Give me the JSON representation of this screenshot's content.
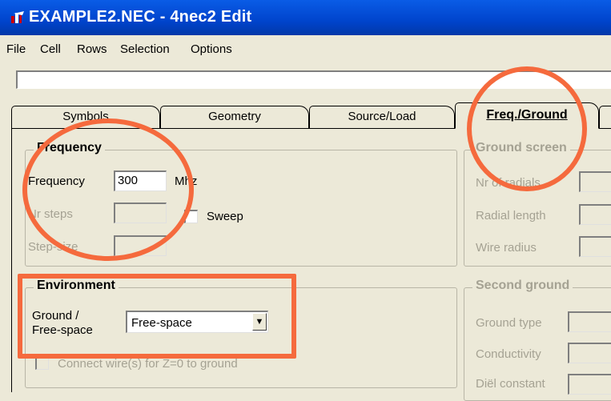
{
  "window": {
    "title": "EXAMPLE2.NEC - 4nec2 Edit"
  },
  "menu": [
    "File",
    "Cell",
    "Rows",
    "Selection",
    "Options"
  ],
  "command_line": {
    "value": ""
  },
  "tabs": [
    {
      "label": "Symbols",
      "active": false
    },
    {
      "label": "Geometry",
      "active": false
    },
    {
      "label": "Source/Load",
      "active": false
    },
    {
      "label": "Freq./Ground",
      "active": true
    }
  ],
  "frequency_group": {
    "legend": "Frequency",
    "frequency_label": "Frequency",
    "frequency_value": "300",
    "unit": "Mhz",
    "nr_steps_label": "Nr steps",
    "nr_steps_value": "",
    "sweep_label": "Sweep",
    "stepsize_label": "Step-size",
    "stepsize_value": ""
  },
  "environment_group": {
    "legend": "Environment",
    "ground_label_line1": "Ground  /",
    "ground_label_line2": "Free-space",
    "ground_selected": "Free-space",
    "connect_label": "Connect wire(s) for Z=0 to ground"
  },
  "ground_screen_group": {
    "legend": "Ground screen",
    "nr_radials_label": "Nr of radials",
    "radial_length_label": "Radial length",
    "wire_radius_label": "Wire radius"
  },
  "second_ground_group": {
    "legend": "Second ground",
    "ground_type_label": "Ground type",
    "conductivity_label": "Conductivity",
    "dielectric_label": "Diël constant"
  },
  "colors": {
    "titlebar": "#0055e5",
    "annotation": "#f56a3d",
    "window_bg": "#ece9d8"
  }
}
